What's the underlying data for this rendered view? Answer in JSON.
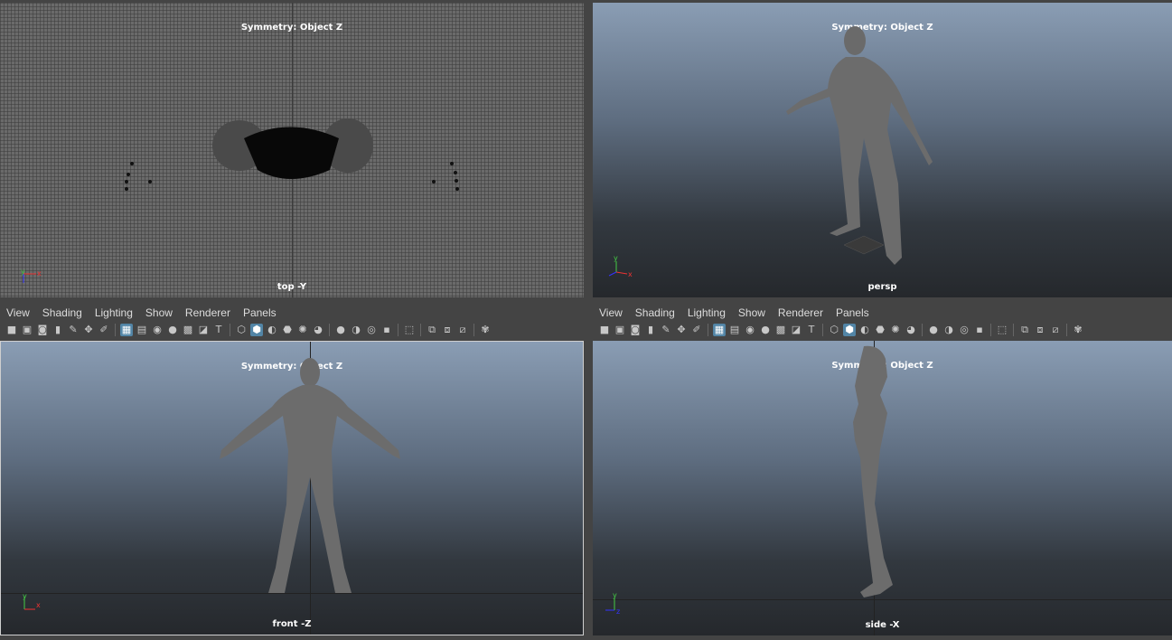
{
  "viewports": {
    "top": {
      "symmetry": "Symmetry: Object Z",
      "camera": "top -Y",
      "axes": [
        "y",
        "x"
      ]
    },
    "persp": {
      "symmetry": "Symmetry: Object Z",
      "camera": "persp",
      "axes": [
        "y",
        "x"
      ]
    },
    "front": {
      "symmetry": "Symmetry: Object Z",
      "camera": "front -Z",
      "axes": [
        "y",
        "x"
      ]
    },
    "side": {
      "symmetry": "Symmetry: Object Z",
      "camera": "side -X",
      "axes": [
        "y",
        "z"
      ]
    }
  },
  "panel_menu": [
    "View",
    "Shading",
    "Lighting",
    "Show",
    "Renderer",
    "Panels"
  ],
  "toolbar_icons": [
    "camera-icon",
    "camera-lock-icon",
    "camera-attr-icon",
    "bookmark-icon",
    "pencil-icon",
    "2d-pan-icon",
    "grease-pencil-icon",
    "grid-icon",
    "film-gate-icon",
    "resolution-gate-icon",
    "gate-mask-icon",
    "field-chart-icon",
    "safe-action-icon",
    "safe-title-icon",
    "wireframe-icon",
    "smooth-shade-icon",
    "wireframe-on-shaded-icon",
    "textured-icon",
    "default-light-icon",
    "shadows-icon",
    "screen-space-ao-icon",
    "motion-blur-icon",
    "multisample-aa-icon",
    "depth-of-field-icon",
    "isolate-select-icon",
    "xray-icon",
    "xray-joints-icon",
    "xray-active-icon",
    "backface-icon"
  ],
  "colors": {
    "accent": "#5285a6",
    "active_border": "#cfcfcf"
  }
}
